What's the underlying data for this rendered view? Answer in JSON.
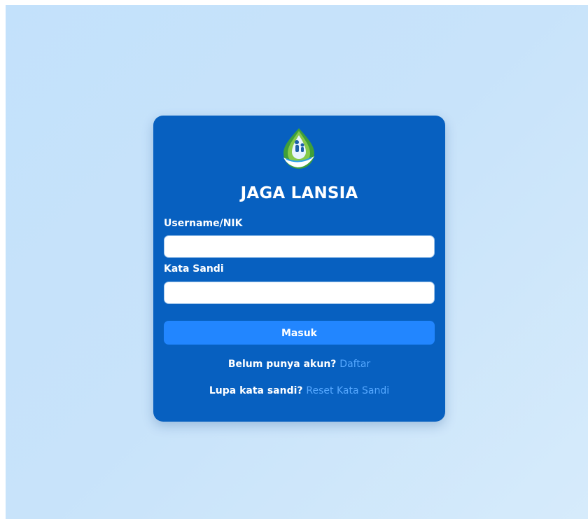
{
  "app": {
    "title": "JAGA LANSIA"
  },
  "form": {
    "username_label": "Username/NIK",
    "username_value": "",
    "password_label": "Kata Sandi",
    "password_value": "",
    "submit_label": "Masuk"
  },
  "footer": {
    "register_prompt": "Belum punya akun?",
    "register_link": "Daftar",
    "reset_prompt": "Lupa kata sandi?",
    "reset_link": "Reset Kata Sandi"
  },
  "colors": {
    "background": "#c8e3fa",
    "card": "#0760c0",
    "button": "#2286ff",
    "link": "#56a8ff"
  },
  "icons": {
    "logo": "jaga-lansia-logo-icon"
  }
}
